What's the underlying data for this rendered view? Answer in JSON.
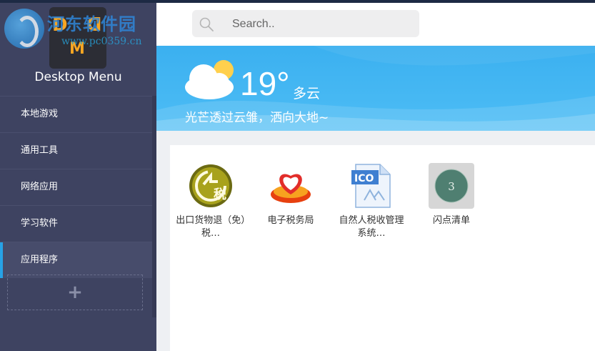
{
  "app": {
    "name": "Desktop Menu",
    "logo_letters": [
      "D",
      "M",
      "D"
    ]
  },
  "watermark": {
    "text": "河东软件园",
    "url": "www.pc0359.cn"
  },
  "sidebar": {
    "items": [
      {
        "label": "本地游戏",
        "active": false
      },
      {
        "label": "通用工具",
        "active": false
      },
      {
        "label": "网络应用",
        "active": false
      },
      {
        "label": "学习软件",
        "active": false
      },
      {
        "label": "应用程序",
        "active": true
      }
    ],
    "add_icon": "plus-icon",
    "add_label": "+"
  },
  "search": {
    "placeholder": "Search..",
    "value": ""
  },
  "weather": {
    "temperature": "19°",
    "condition": "多云",
    "tagline": "光芒透过云雏，洒向大地~",
    "icon": "partly-cloudy-icon"
  },
  "apps": [
    {
      "label": "出口货物退（免）税…",
      "icon": "export-tax-refund-icon"
    },
    {
      "label": "电子税务局",
      "icon": "e-tax-bureau-icon"
    },
    {
      "label": "自然人税收管理系统…",
      "icon": "ico-file-icon",
      "icon_text": "ICO"
    },
    {
      "label": "闪点清单",
      "icon": "flash-list-icon",
      "icon_text": "3"
    }
  ],
  "colors": {
    "sidebar_bg": "#3e4361",
    "accent": "#27a2e6",
    "weather_bg": "#3bb0f0"
  }
}
